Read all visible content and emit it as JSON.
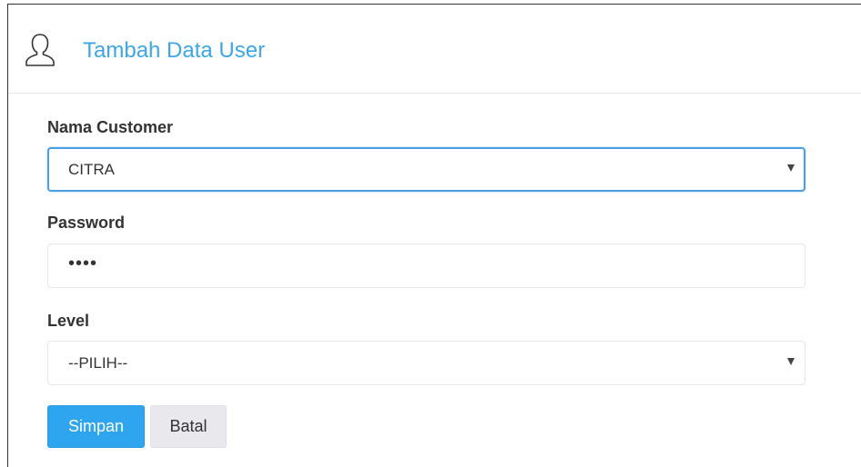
{
  "header": {
    "title": "Tambah Data User",
    "icon": "user-icon"
  },
  "form": {
    "customer": {
      "label": "Nama Customer",
      "selected": "CITRA"
    },
    "password": {
      "label": "Password",
      "masked_value": "••••"
    },
    "level": {
      "label": "Level",
      "selected": "--PILIH--"
    }
  },
  "actions": {
    "save_label": "Simpan",
    "cancel_label": "Batal"
  },
  "colors": {
    "accent": "#3ea6e6",
    "primary_button": "#2fa4ef",
    "default_button": "#e8e8ed",
    "focus_border": "#4a9fe6"
  }
}
